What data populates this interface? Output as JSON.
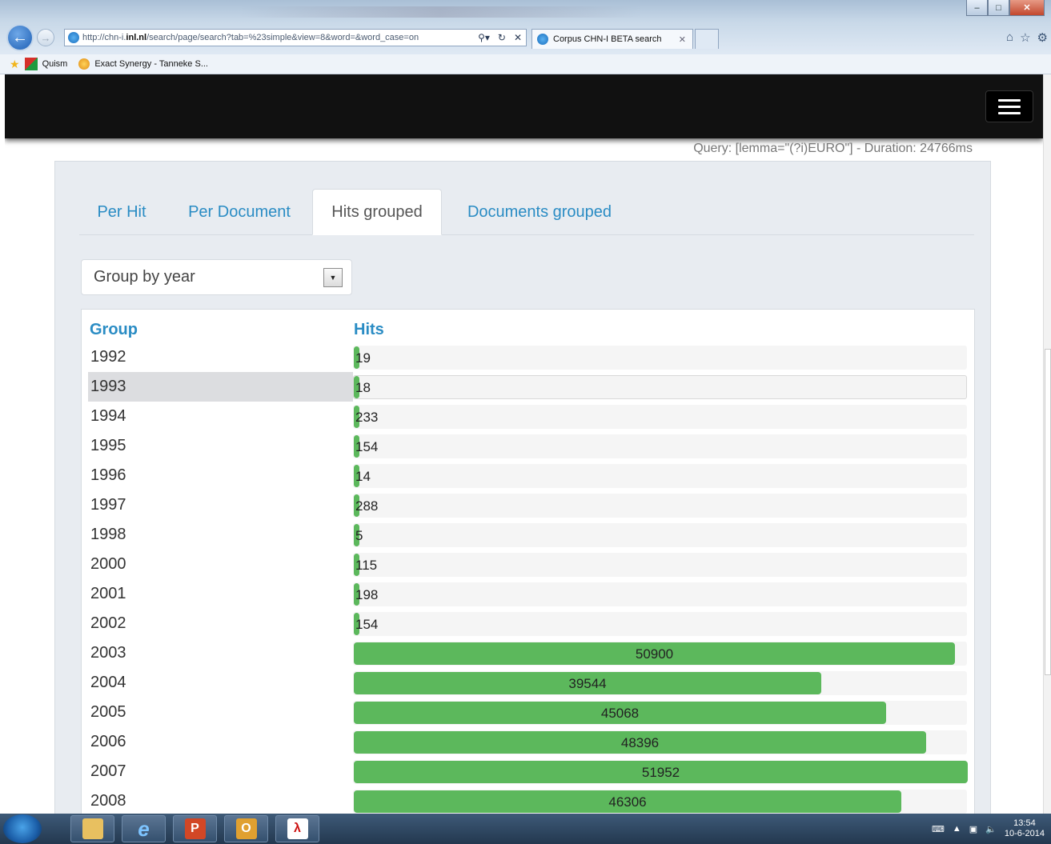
{
  "browser": {
    "url_prefix": "http://chn-i.",
    "url_domain": "inl.nl",
    "url_rest": "/search/page/search?tab=%23simple&view=8&word=&word_case=on",
    "tab_title": "Corpus CHN-I BETA search",
    "favorites": [
      "Quism",
      "Exact Synergy - Tanneke S..."
    ]
  },
  "query_info": "Query: [lemma=\"(?i)EURO\"] - Duration: 24766ms",
  "tabs": [
    {
      "label": "Per Hit"
    },
    {
      "label": "Per Document"
    },
    {
      "label": "Hits grouped"
    },
    {
      "label": "Documents grouped"
    }
  ],
  "group_by": {
    "selected": "Group by year"
  },
  "table": {
    "headers": {
      "group": "Group",
      "hits": "Hits"
    },
    "max_value": 51952,
    "rows": [
      {
        "group": "1992",
        "hits": "19"
      },
      {
        "group": "1993",
        "hits": "18"
      },
      {
        "group": "1994",
        "hits": "233"
      },
      {
        "group": "1995",
        "hits": "154"
      },
      {
        "group": "1996",
        "hits": "14"
      },
      {
        "group": "1997",
        "hits": "288"
      },
      {
        "group": "1998",
        "hits": "5"
      },
      {
        "group": "2000",
        "hits": "115"
      },
      {
        "group": "2001",
        "hits": "198"
      },
      {
        "group": "2002",
        "hits": "154"
      },
      {
        "group": "2003",
        "hits": "50900"
      },
      {
        "group": "2004",
        "hits": "39544"
      },
      {
        "group": "2005",
        "hits": "45068"
      },
      {
        "group": "2006",
        "hits": "48396"
      },
      {
        "group": "2007",
        "hits": "51952"
      },
      {
        "group": "2008",
        "hits": "46306"
      }
    ]
  },
  "taskbar": {
    "time": "13:54",
    "date": "10-6-2014"
  }
}
